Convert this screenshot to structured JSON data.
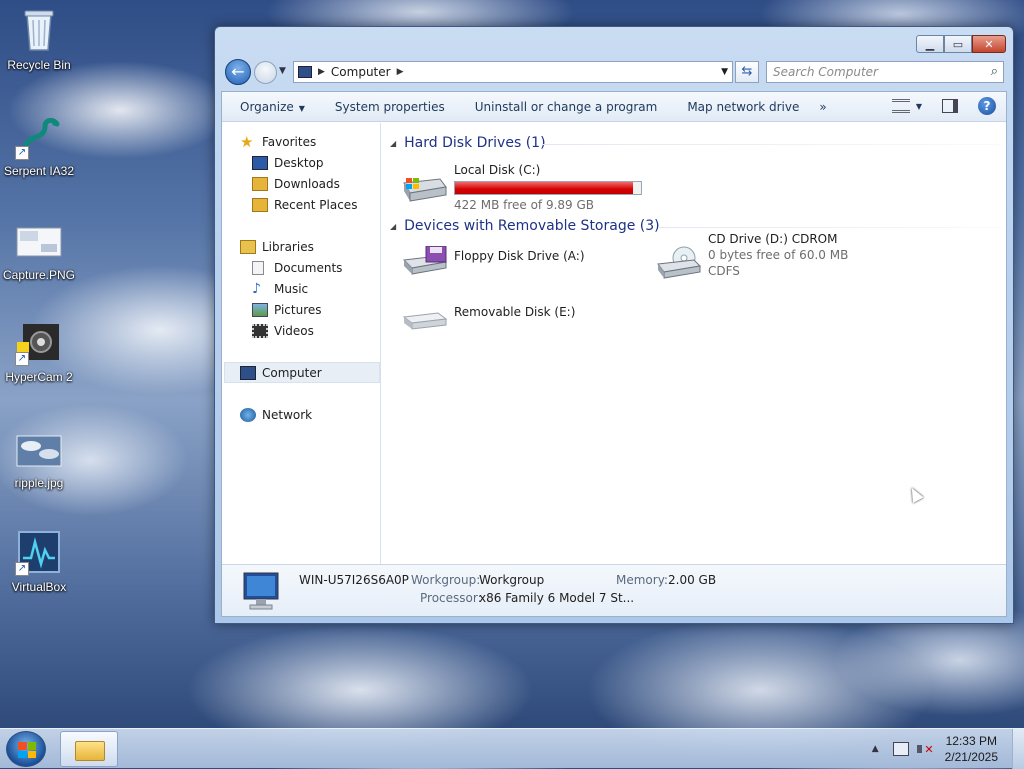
{
  "desktop": {
    "icons": [
      {
        "label": "Recycle Bin",
        "icon": "recycle-bin-icon"
      },
      {
        "label": "Serpent IA32",
        "icon": "serpent-icon"
      },
      {
        "label": "Capture.PNG",
        "icon": "image-file-icon"
      },
      {
        "label": "HyperCam 2",
        "icon": "hypercam-icon"
      },
      {
        "label": "ripple.jpg",
        "icon": "image-file-icon"
      },
      {
        "label": "VirtualBox",
        "icon": "virtualbox-icon"
      }
    ]
  },
  "window": {
    "address": {
      "crumbs": [
        "Computer"
      ]
    },
    "search": {
      "placeholder": "Search Computer"
    },
    "toolbar": {
      "organize": "Organize",
      "system_properties": "System properties",
      "uninstall": "Uninstall or change a program",
      "map_drive": "Map network drive",
      "more": "»"
    },
    "nav": {
      "favorites": "Favorites",
      "desktop": "Desktop",
      "downloads": "Downloads",
      "recent": "Recent Places",
      "libraries": "Libraries",
      "documents": "Documents",
      "music": "Music",
      "pictures": "Pictures",
      "videos": "Videos",
      "computer": "Computer",
      "network": "Network"
    },
    "groups": {
      "hard_disks": {
        "title": "Hard Disk Drives (1)",
        "drives": [
          {
            "name": "Local Disk (C:)",
            "free_text": "422 MB free of 9.89 GB",
            "used_fraction": 0.958
          }
        ]
      },
      "removable": {
        "title": "Devices with Removable Storage (3)",
        "drives": [
          {
            "name": "Floppy Disk Drive (A:)"
          },
          {
            "name": "CD Drive (D:) CDROM",
            "free_text": "0 bytes free of 60.0 MB",
            "fs": "CDFS"
          },
          {
            "name": "Removable Disk (E:)"
          }
        ]
      }
    },
    "details": {
      "computer_name": "WIN-U57I26S6A0P",
      "workgroup_label": "Workgroup:",
      "workgroup": "Workgroup",
      "memory_label": "Memory:",
      "memory": "2.00 GB",
      "processor_label": "Processor:",
      "processor": "x86 Family 6 Model 7 St..."
    }
  },
  "taskbar": {
    "time": "12:33 PM",
    "date": "2/21/2025",
    "tray_arrow": "▲"
  },
  "colors": {
    "usage_bar_fill": "#d40000",
    "group_title": "#1e3287",
    "accent": "#1f5fb4"
  }
}
